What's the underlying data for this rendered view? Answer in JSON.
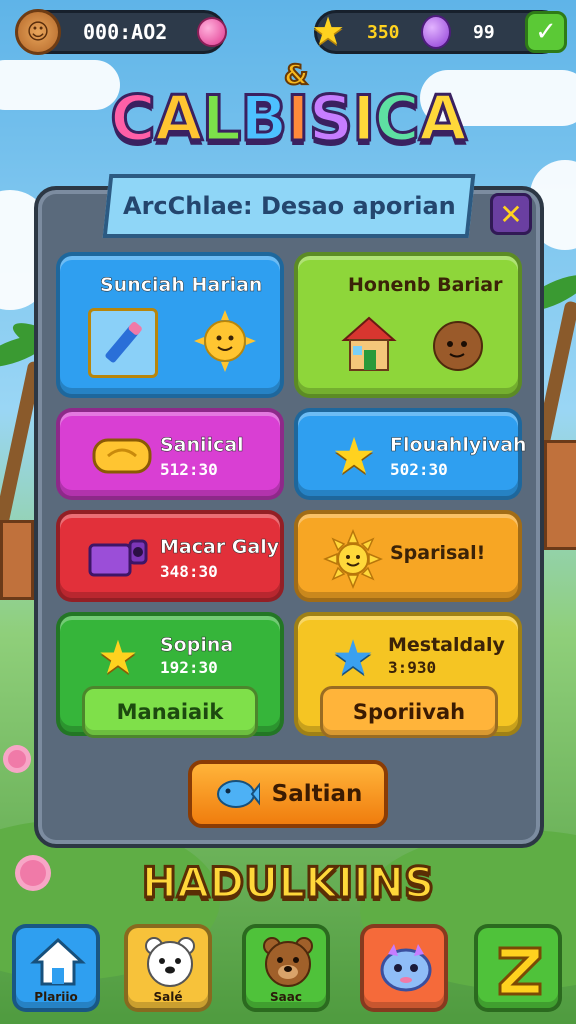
{
  "hud": {
    "coins_value": "000:AO2",
    "stars_value": "350",
    "gems_value": "99",
    "plus_symbol": "✓"
  },
  "title": {
    "amp": "&",
    "letters": [
      "C",
      "A",
      "L",
      "B",
      "I",
      "S",
      "I",
      "C",
      "A"
    ]
  },
  "dialog": {
    "banner": "ArcChlae: Desao aporian",
    "close_symbol": "✕",
    "cards": [
      {
        "title": "Sunciah Harian",
        "color": "#2f9ff0",
        "icons": [
          "pencil-icon",
          "sun-character-icon"
        ]
      },
      {
        "title": "Honenb Bariar",
        "color": "#8ed63a",
        "icons": [
          "house-gift-icon",
          "coconut-character-icon"
        ]
      },
      {
        "title": "Saniical",
        "sub": "512:30",
        "color": "#d93fd3",
        "icon": "coin-bar-icon"
      },
      {
        "title": "Flouahlyivah",
        "sub": "502:30",
        "color": "#2f9ff0",
        "icon": "star-icon"
      },
      {
        "title": "Macar Galy",
        "sub": "348:30",
        "color": "#e2303a",
        "icon": "camera-icon"
      },
      {
        "title": "Sparisal!",
        "color": "#f7a624",
        "icon": "sun-icon"
      },
      {
        "title": "Sopina",
        "sub": "192:30",
        "color": "#36b53a",
        "icon": "star-icon",
        "button": "Manaiaik"
      },
      {
        "title": "Mestaldaly",
        "sub": "3:930",
        "color": "#f5c523",
        "icon": "blue-star-icon",
        "button": "Sporiivah"
      }
    ],
    "main_button": "Saltian"
  },
  "bottom_title": "HADULKIINS",
  "nav": [
    {
      "label": "Plariio",
      "color": "#2f9ff0",
      "icon": "home-icon"
    },
    {
      "label": "Salé",
      "color": "#f7c23a",
      "icon": "polar-bear-icon"
    },
    {
      "label": "Saac",
      "color": "#4fc23a",
      "icon": "bear-icon"
    },
    {
      "label": "",
      "color": "#f56a3a",
      "icon": "creature-icon"
    },
    {
      "label": "",
      "color": "#4fc23a",
      "icon": "letter-z-icon"
    }
  ]
}
